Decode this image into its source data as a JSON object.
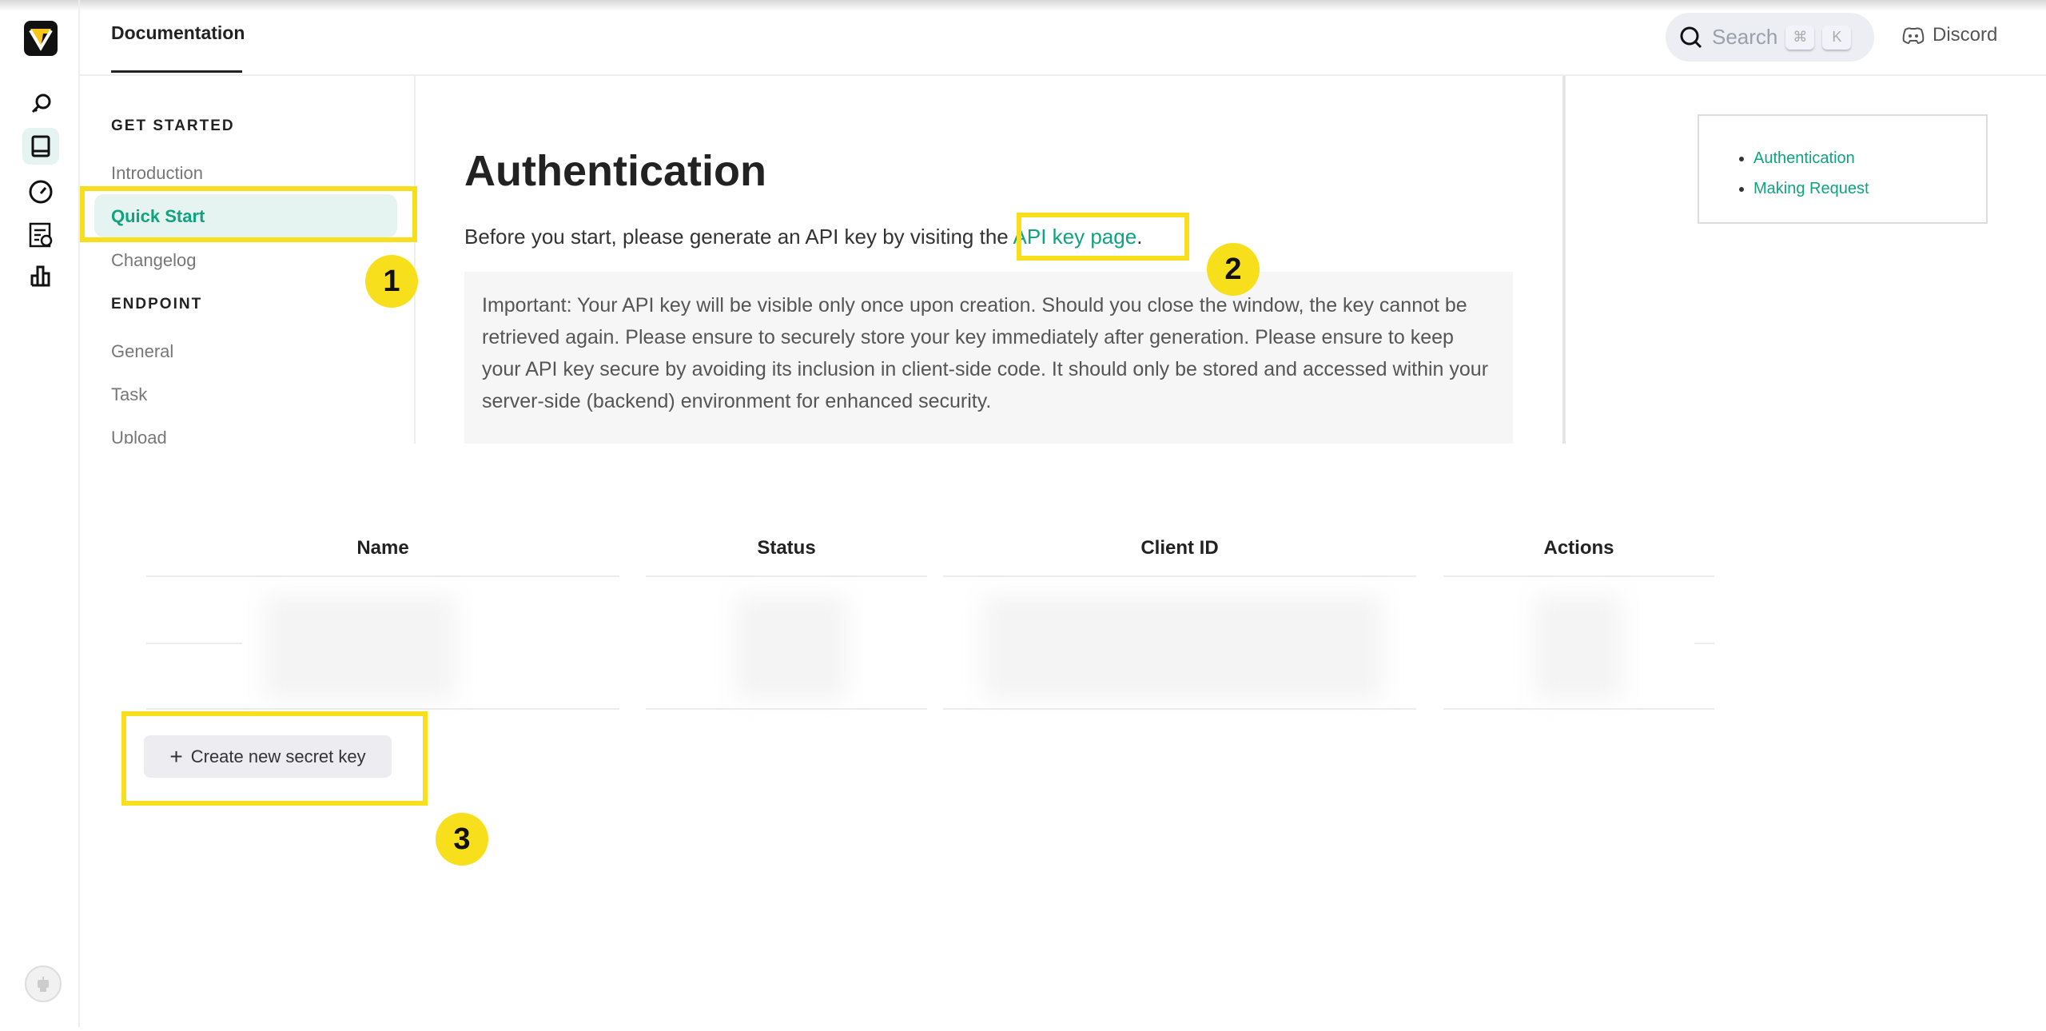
{
  "header": {
    "tab": "Documentation",
    "search_placeholder": "Search",
    "shortcut_keys": [
      "⌘",
      "K"
    ],
    "discord": "Discord"
  },
  "rail": {
    "items": [
      "search-icon",
      "book-icon",
      "dashboard-gauge-icon",
      "task-schedule-icon",
      "bar-chart-icon"
    ],
    "avatar": "robot-avatar"
  },
  "nav": {
    "sections": [
      {
        "title": "GET STARTED",
        "items": [
          "Introduction",
          "Quick Start",
          "Changelog"
        ]
      },
      {
        "title": "ENDPOINT",
        "items": [
          "General",
          "Task",
          "Upload"
        ]
      }
    ],
    "active": "Quick Start"
  },
  "content": {
    "title": "Authentication",
    "intro_before": "Before you start, please generate an API key by visiting the ",
    "intro_link": "API key page",
    "intro_after": ".",
    "note": "Important: Your API key will be visible only once upon creation. Should you close the window, the key cannot be retrieved again. Please ensure to securely store your key immediately after generation. Please ensure to keep your API key secure by avoiding its inclusion in client-side code. It should only be stored and accessed within your server-side (backend) environment for enhanced security."
  },
  "toc": [
    "Authentication",
    "Making Request"
  ],
  "keys_table": {
    "columns": [
      "Name",
      "Status",
      "Client ID",
      "Actions"
    ],
    "create_button": "Create new secret key"
  },
  "annotations": [
    "1",
    "2",
    "3"
  ],
  "colors": {
    "accent": "#10a37f",
    "highlight": "#f8df1c"
  }
}
